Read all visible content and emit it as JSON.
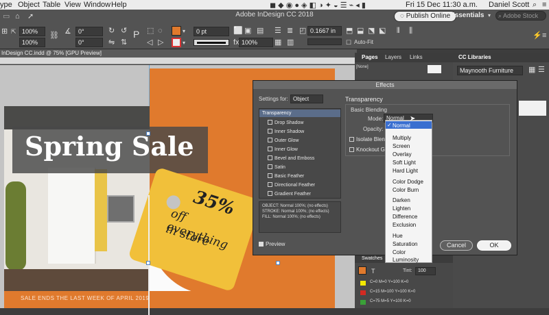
{
  "menubar": {
    "items": [
      "ype",
      "Object",
      "Table",
      "View",
      "Window",
      "Help"
    ],
    "clock": "Fri 15 Dec 11:30 a.m.",
    "user": "Daniel Scott"
  },
  "window": {
    "title": "Adobe InDesign CC 2018",
    "publish_label": "Publish Online",
    "workspace": "Essentials",
    "stock_placeholder": "Adobe Stock"
  },
  "control": {
    "scale_x": "100%",
    "scale_y": "100%",
    "rotate": "0°",
    "shear": "0°",
    "stroke_weight": "0 pt",
    "opacity": "100%",
    "ref": "0.1667 in",
    "autofit": "Auto-Fit"
  },
  "doc": {
    "tab": "InDesign CC.indd @ 75% [GPU Preview]"
  },
  "ad": {
    "headline": "Spring Sale",
    "tag1": "35%",
    "tag2": "off everything",
    "tag3": "in store",
    "footer": "SALE ENDS THE LAST WEEK OF APRIL 2019"
  },
  "effects": {
    "title": "Effects",
    "settings_label": "Settings for:",
    "settings_value": "Object",
    "section": "Transparency",
    "basic": "Basic Blending",
    "mode_label": "Mode:",
    "mode_value": "Normal",
    "opacity_label": "Opacity:",
    "isolate": "Isolate Blend",
    "knockout": "Knockout G",
    "list": [
      "Transparency",
      "Drop Shadow",
      "Inner Shadow",
      "Outer Glow",
      "Inner Glow",
      "Bevel and Emboss",
      "Satin",
      "Basic Feather",
      "Directional Feather",
      "Gradient Feather"
    ],
    "summary": [
      "OBJECT: Normal 100%; (no effects)",
      "STROKE: Normal 100%; (no effects)",
      "FILL: Normal 100%; (no effects)"
    ],
    "preview": "Preview",
    "cancel": "Cancel",
    "ok": "OK"
  },
  "blend_modes": [
    "Normal",
    "Multiply",
    "Screen",
    "Overlay",
    "Soft Light",
    "Hard Light",
    "Color Dodge",
    "Color Burn",
    "Darken",
    "Lighten",
    "Difference",
    "Exclusion",
    "Hue",
    "Saturation",
    "Color",
    "Luminosity"
  ],
  "pages": {
    "tabs": [
      "Pages",
      "Layers",
      "Links"
    ],
    "none": "[None]"
  },
  "cclib": {
    "tab": "CC Libraries",
    "library": "Maynooth Furniture"
  },
  "swatches": {
    "tab": "Swatches",
    "tint_label": "Tint:",
    "tint": "100",
    "items": [
      "C=0 M=0 Y=100 K=0",
      "C=15 M=100 Y=100 K=0",
      "C=75 M=5 Y=100 K=0"
    ]
  }
}
